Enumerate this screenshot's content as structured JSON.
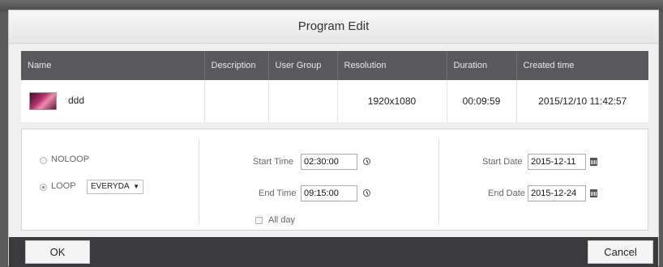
{
  "dialog": {
    "title": "Program Edit"
  },
  "table": {
    "columns": [
      "Name",
      "Description",
      "User Group",
      "Resolution",
      "Duration",
      "Created time"
    ],
    "rows": [
      {
        "name": "ddd",
        "description": "",
        "user_group": "",
        "resolution": "1920x1080",
        "duration": "00:09:59",
        "created": "2015/12/10 11:42:57"
      }
    ]
  },
  "loop": {
    "noloop_label": "NOLOOP",
    "loop_label": "LOOP",
    "selected": "LOOP",
    "loop_select_value": "EVERYDA"
  },
  "time": {
    "start_label": "Start Time",
    "start_value": "02:30:00",
    "end_label": "End Time",
    "end_value": "09:15:00",
    "allday_label": "All day"
  },
  "date": {
    "start_label": "Start Date",
    "start_value": "2015-12-11",
    "end_label": "End Date",
    "end_value": "2015-12-24"
  },
  "buttons": {
    "ok": "OK",
    "cancel": "Cancel"
  },
  "icons": {
    "time": "clock-icon",
    "date": "calendar-icon",
    "select": "dropdown-arrow-icon"
  }
}
